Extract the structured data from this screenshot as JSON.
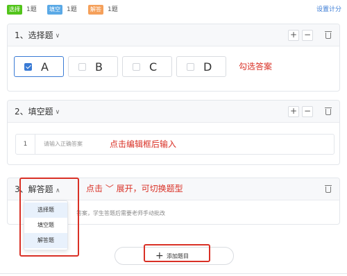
{
  "topbar": {
    "tags": [
      {
        "label": "选择",
        "count": "1题",
        "color": "#52c41a"
      },
      {
        "label": "填空",
        "count": "1题",
        "color": "#5aa9e6"
      },
      {
        "label": "解答",
        "count": "1题",
        "color": "#f5a05a"
      }
    ],
    "settings_label": "设置计分"
  },
  "q1": {
    "title": "1、选择题",
    "options": [
      {
        "label": "A",
        "checked": true
      },
      {
        "label": "B",
        "checked": false
      },
      {
        "label": "C",
        "checked": false
      },
      {
        "label": "D",
        "checked": false
      }
    ],
    "note": "勾选答案"
  },
  "q2": {
    "title": "2、填空题",
    "row_number": "1",
    "placeholder": "请输入正确答案",
    "note": "点击编辑框后输入"
  },
  "q3": {
    "title_num": "3、",
    "title": "解答题",
    "desc_fragment": "答案，学生答题后需要老师手动批改",
    "note": "点击 ﹀ 展开，可切换题型",
    "dropdown": [
      "选择题",
      "填空题",
      "解答题"
    ]
  },
  "add_question_label": "添加题目",
  "colors": {
    "accent": "#3a7bd5",
    "annotation_red": "#d93025"
  }
}
